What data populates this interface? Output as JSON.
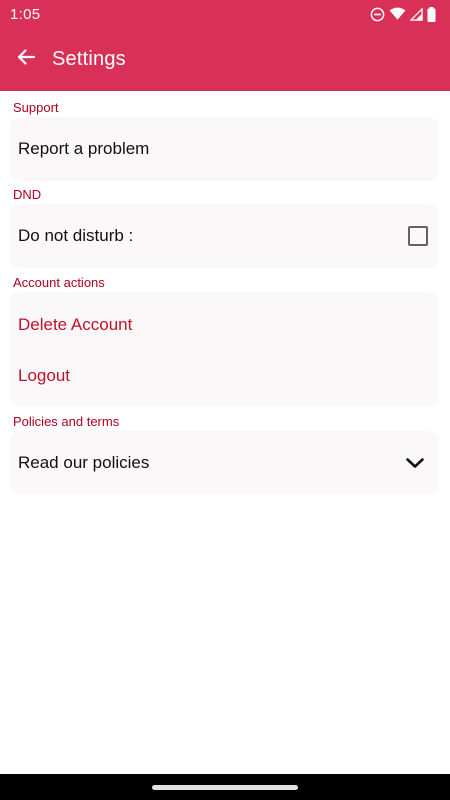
{
  "status_bar": {
    "time": "1:05",
    "icons": [
      "do-not-disturb-icon",
      "wifi-icon",
      "signal-icon",
      "battery-icon"
    ]
  },
  "app_bar": {
    "back_icon": "arrow-left-icon",
    "title": "Settings"
  },
  "sections": {
    "support": {
      "header": "Support",
      "items": [
        "Report a problem"
      ]
    },
    "dnd": {
      "header": "DND",
      "label": "Do not disturb :",
      "checked": false
    },
    "account_actions": {
      "header": "Account actions",
      "items": [
        "Delete Account",
        "Logout"
      ]
    },
    "policies": {
      "header": "Policies and terms",
      "label": "Read our policies",
      "expand_icon": "chevron-down-icon"
    }
  },
  "colors": {
    "primary": "#d93058",
    "section_header": "#b00020",
    "danger_text": "#c0102a",
    "card_background": "#faf8f8"
  }
}
